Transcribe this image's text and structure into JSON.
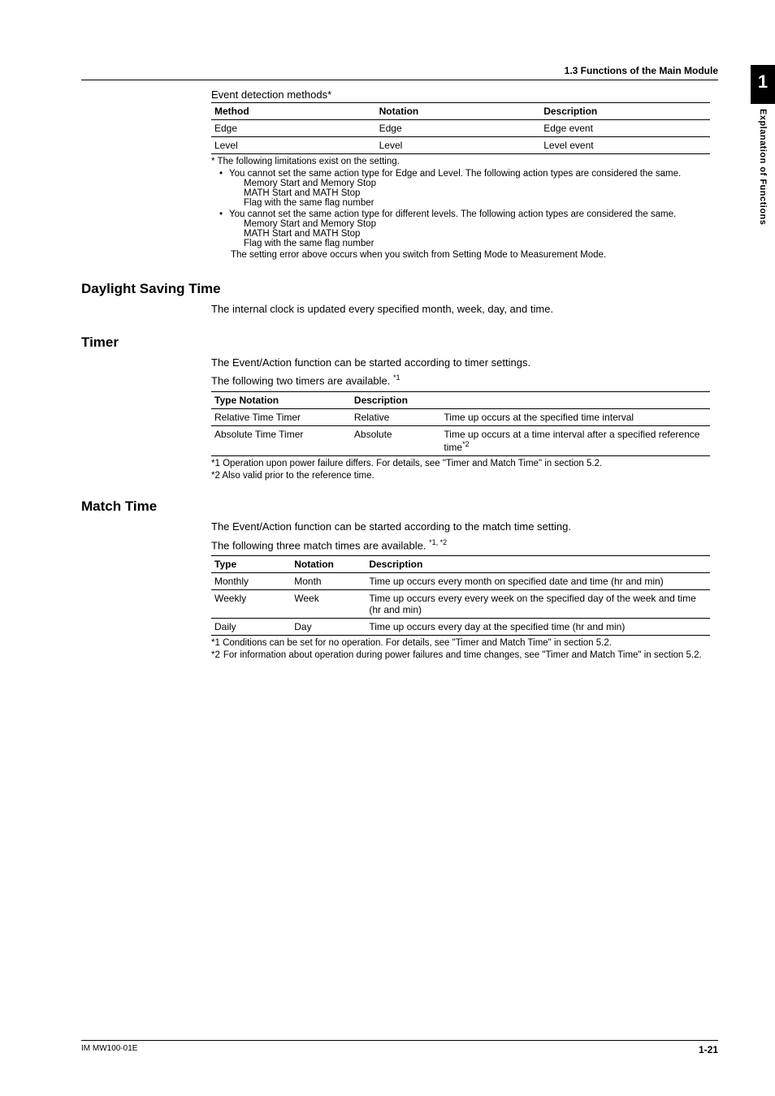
{
  "running_head": "1.3  Functions of the Main Module",
  "side": {
    "chapter_num": "1",
    "label": "Explanation of Functions"
  },
  "event_methods": {
    "title": "Event detection methods*",
    "headers": [
      "Method",
      "Notation",
      "Description"
    ],
    "rows": [
      [
        "Edge",
        "Edge",
        "Edge event"
      ],
      [
        "Level",
        "Level",
        "Level event"
      ]
    ],
    "footnote": "* The following limitations exist on the setting.",
    "bullet1": "You cannot set the same action type for Edge and Level. The following action types are considered the same.",
    "sub1": [
      "Memory Start and Memory Stop",
      "MATH Start and MATH Stop",
      "Flag with the same flag number"
    ],
    "bullet2": "You cannot set the same action type for different levels. The following action types are considered the same.",
    "sub2": [
      "Memory Start and Memory Stop",
      "MATH Start and MATH Stop",
      "Flag with the same flag number"
    ],
    "closing": "The setting error above occurs when you switch from Setting Mode to Measurement Mode."
  },
  "dst": {
    "heading": "Daylight Saving Time",
    "body": "The internal clock is updated every specified month, week, day, and time."
  },
  "timer": {
    "heading": "Timer",
    "body1": "The Event/Action function can be started according to timer settings.",
    "body2_pre": "The following two timers are available. ",
    "body2_sup": "*1",
    "headers": [
      "Type Notation",
      "Description",
      ""
    ],
    "rows": [
      [
        "Relative Time Timer",
        "Relative",
        "Time up occurs at the specified time interval"
      ],
      [
        "Absolute Time Timer",
        "Absolute",
        "Time up occurs at a time interval after a specified reference time"
      ]
    ],
    "row1_sup": "*2",
    "fn1": "*1  Operation upon power failure differs. For details, see \"Timer and Match Time\" in section 5.2.",
    "fn2": "*2  Also valid prior to the reference time."
  },
  "match": {
    "heading": "Match Time",
    "body1": "The Event/Action function can be started according to the match time setting.",
    "body2_pre": "The following three match times are available. ",
    "body2_sup": "*1, *2",
    "headers": [
      "Type",
      "Notation",
      "Description"
    ],
    "rows": [
      [
        "Monthly",
        "Month",
        "Time up occurs every month on specified date and time (hr and min)"
      ],
      [
        "Weekly",
        "Week",
        "Time up occurs every every week on the specified day of the week and time (hr and min)"
      ],
      [
        "Daily",
        "Day",
        "Time up occurs every day at the specified time (hr and min)"
      ]
    ],
    "fn1": "*1  Conditions can be set for no operation. For details, see \"Timer and Match Time\" in section 5.2.",
    "fn2_tag": "*2",
    "fn2_body": "For information about operation during power failures and time changes, see \"Timer and Match Time\" in section 5.2."
  },
  "footer": {
    "doc_id": "IM MW100-01E",
    "page_num": "1-21"
  }
}
